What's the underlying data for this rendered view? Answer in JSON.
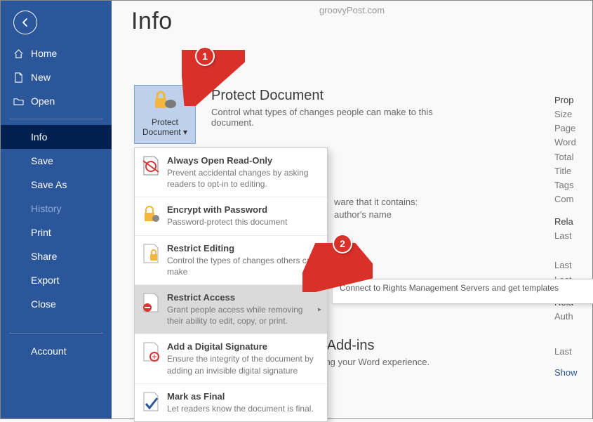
{
  "watermark": "groovyPost.com",
  "title": "Info",
  "sidebar": {
    "items": [
      {
        "label": "Home",
        "icon": "home-icon"
      },
      {
        "label": "New",
        "icon": "newdoc-icon"
      },
      {
        "label": "Open",
        "icon": "open-icon"
      },
      {
        "label": "Info",
        "selected": true
      },
      {
        "label": "Save"
      },
      {
        "label": "Save As"
      },
      {
        "label": "History",
        "dim": true
      },
      {
        "label": "Print"
      },
      {
        "label": "Share"
      },
      {
        "label": "Export"
      },
      {
        "label": "Close"
      },
      {
        "label": "Account"
      }
    ]
  },
  "protect": {
    "tile_label_1": "Protect",
    "tile_label_2": "Document",
    "heading": "Protect Document",
    "subtext": "Control what types of changes people can make to this document."
  },
  "dropdown": [
    {
      "title": "Always Open Read-Only",
      "desc": "Prevent accidental changes by asking readers to opt-in to editing."
    },
    {
      "title": "Encrypt with Password",
      "desc": "Password-protect this document"
    },
    {
      "title": "Restrict Editing",
      "desc": "Control the types of changes others can make"
    },
    {
      "title": "Restrict Access",
      "desc": "Grant people access while removing their ability to edit, copy, or print.",
      "submenu": true
    },
    {
      "title": "Add a Digital Signature",
      "desc": "Ensure the integrity of the document by adding an invisible digital signature"
    },
    {
      "title": "Mark as Final",
      "desc": "Let readers know the document is final."
    }
  ],
  "flyout": "Connect to Rights Management Servers and get templates",
  "bg": {
    "aware": "ware that it contains:",
    "author": "author's name",
    "addins": "OM Add-ins",
    "affect": "affecting your Word experience."
  },
  "properties": {
    "header": "Prop",
    "rows": [
      "Size",
      "Page",
      "Word",
      "Total",
      "Title",
      "Tags",
      "Com"
    ],
    "related_dates": "Rela",
    "last1": "Last",
    "last2": "Last",
    "last3": "Last",
    "related_people": "Rela",
    "author": "Auth",
    "last4": "Last",
    "show": "Show"
  },
  "annotations": {
    "badge1": "1",
    "badge2": "2"
  }
}
